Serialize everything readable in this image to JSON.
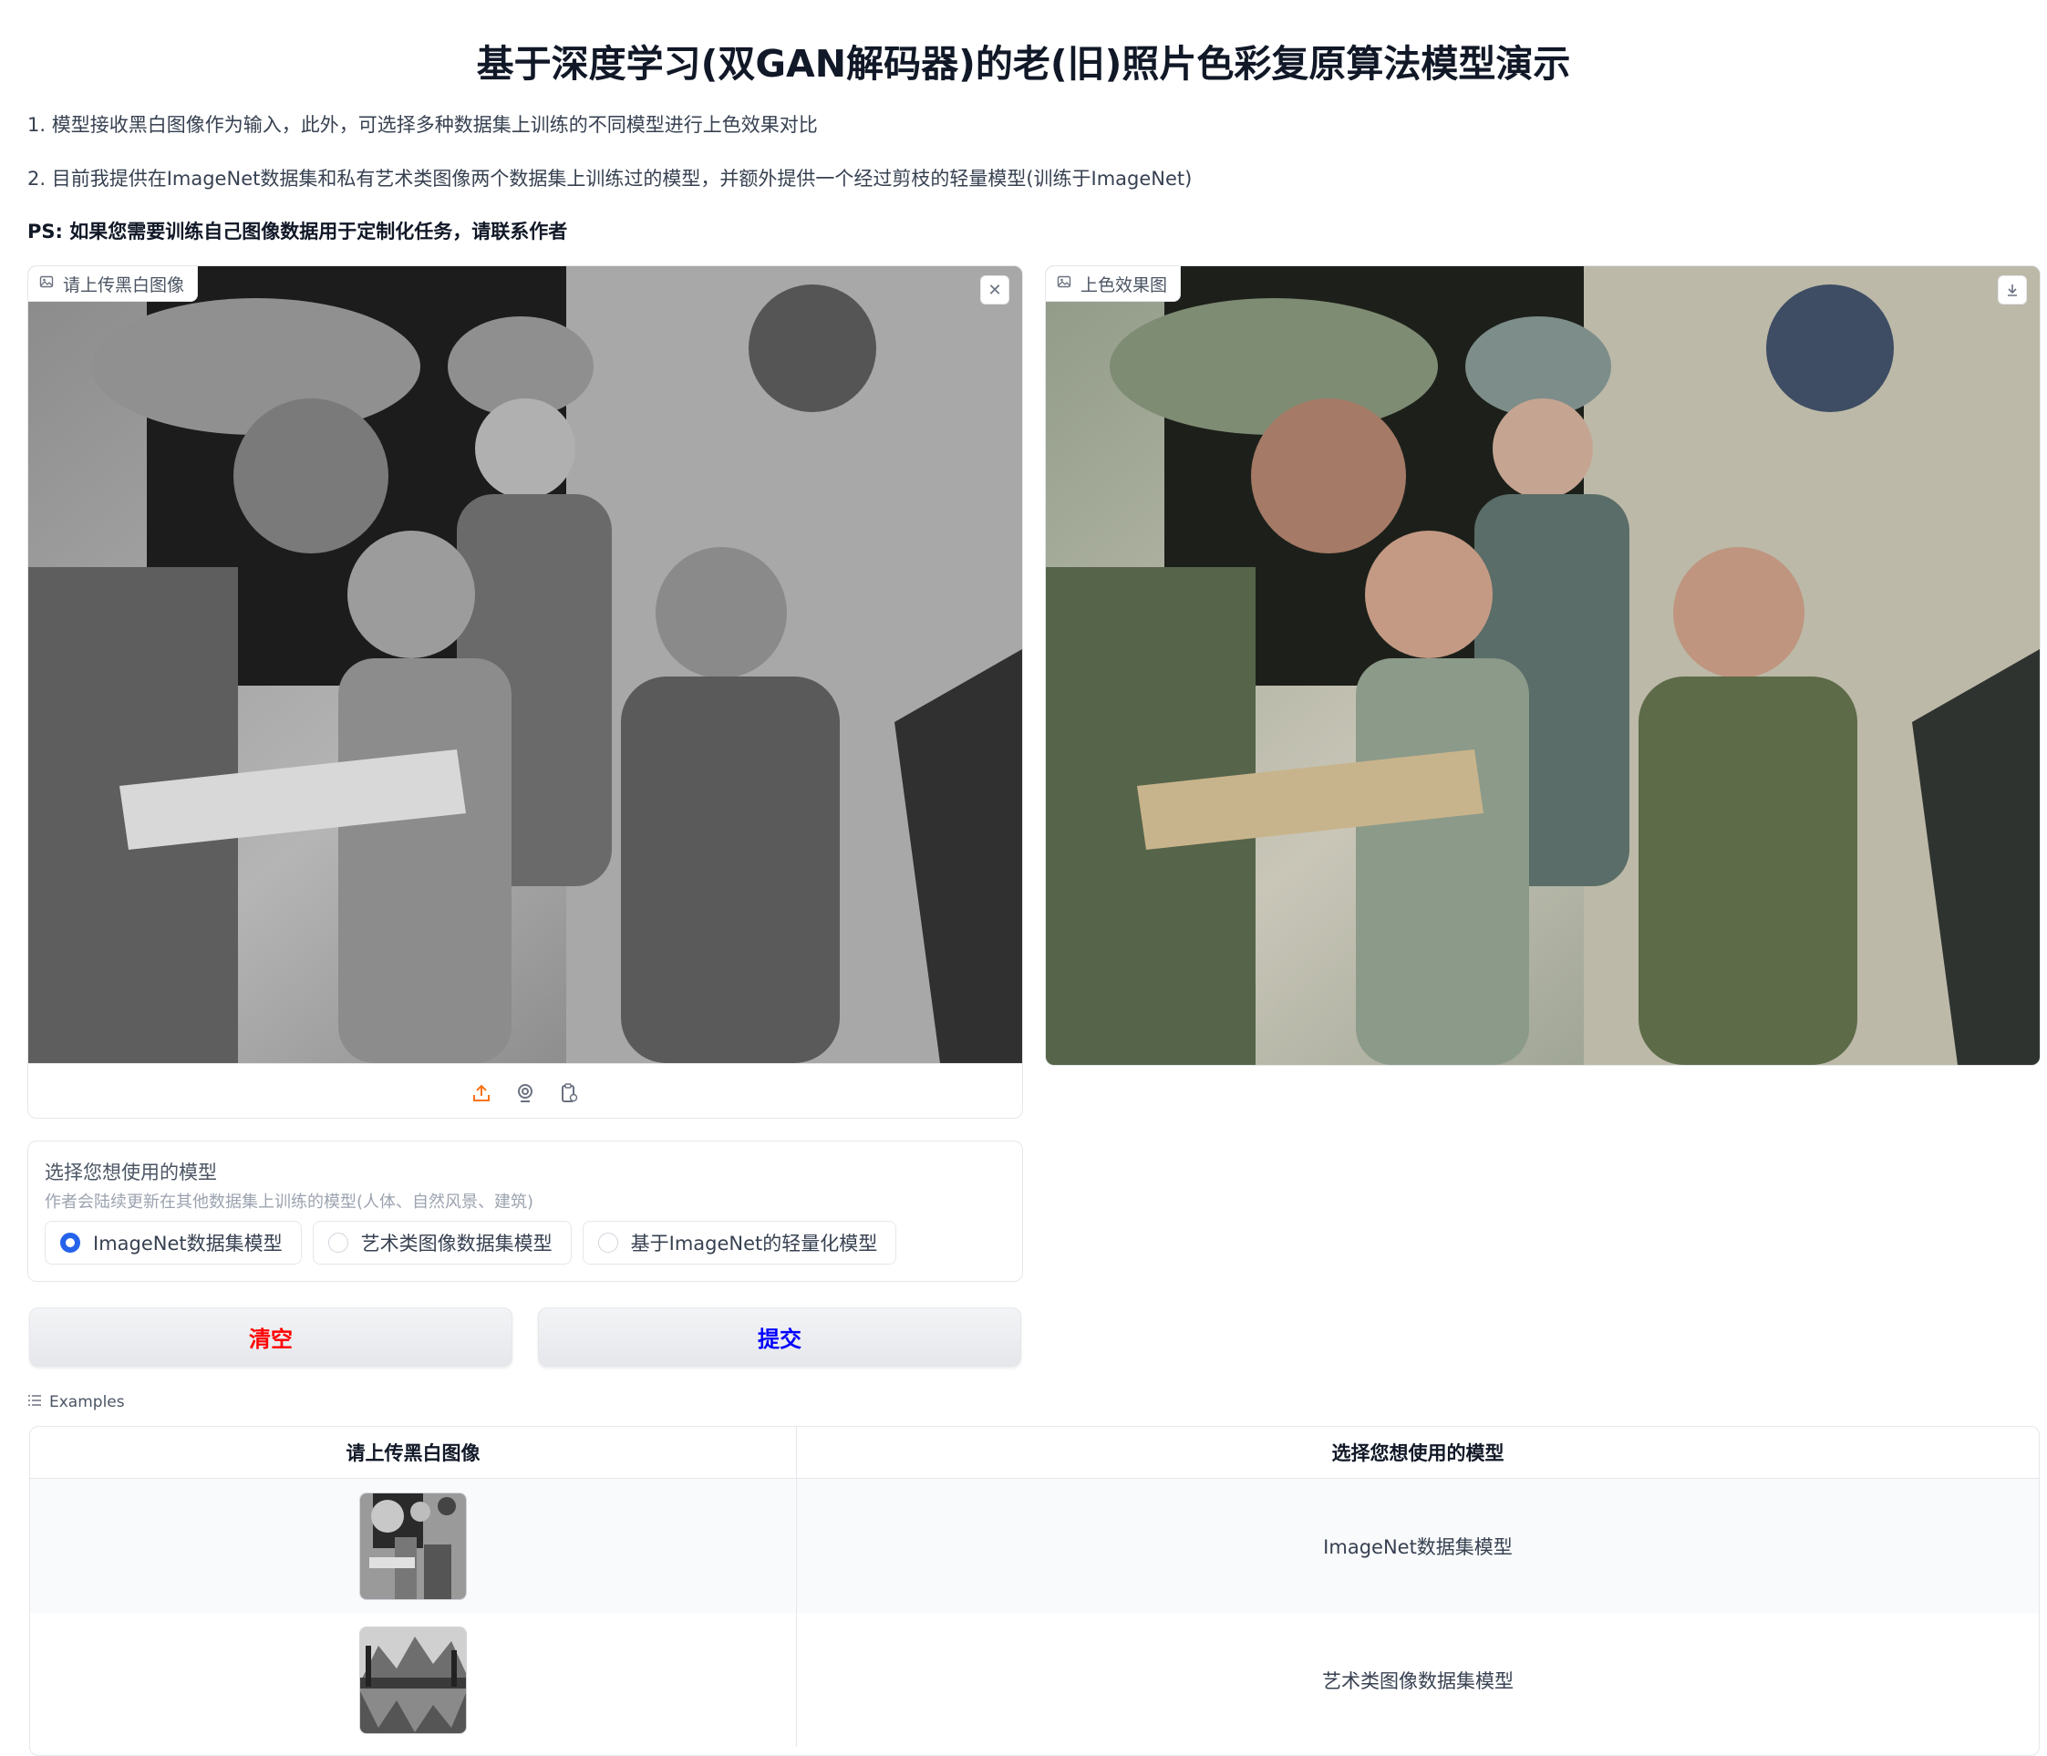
{
  "header": {
    "title": "基于深度学习(双GAN解码器)的老(旧)照片色彩复原算法模型演示",
    "line1": "1. 模型接收黑白图像作为输入，此外，可选择多种数据集上训练的不同模型进行上色效果对比",
    "line2": "2. 目前我提供在ImageNet数据集和私有艺术类图像两个数据集上训练过的模型，并额外提供一个经过剪枝的轻量模型(训练于ImageNet)",
    "ps_label": "PS:",
    "ps_text": "如果您需要训练自己图像数据用于定制化任务，请联系作者"
  },
  "input_panel": {
    "label": "请上传黑白图像",
    "clear_icon": "close-icon",
    "source_icons": [
      "upload-icon",
      "webcam-icon",
      "clipboard-icon"
    ]
  },
  "output_panel": {
    "label": "上色效果图",
    "download_icon": "download-icon"
  },
  "model_selector": {
    "label": "选择您想使用的模型",
    "info": "作者会陆续更新在其他数据集上训练的模型(人体、自然风景、建筑)",
    "options": [
      "ImageNet数据集模型",
      "艺术类图像数据集模型",
      "基于ImageNet的轻量化模型"
    ],
    "selected": "ImageNet数据集模型"
  },
  "buttons": {
    "clear": "清空",
    "submit": "提交",
    "clear_color": "#ff0000",
    "submit_color": "#0000ff"
  },
  "examples": {
    "label": "Examples",
    "headers": [
      "请上传黑白图像",
      "选择您想使用的模型"
    ],
    "rows": [
      {
        "model": "ImageNet数据集模型"
      },
      {
        "model": "艺术类图像数据集模型"
      }
    ]
  },
  "colors": {
    "accent": "#2563eb",
    "border": "#e5e7eb",
    "upload_icon": "#f97316"
  }
}
